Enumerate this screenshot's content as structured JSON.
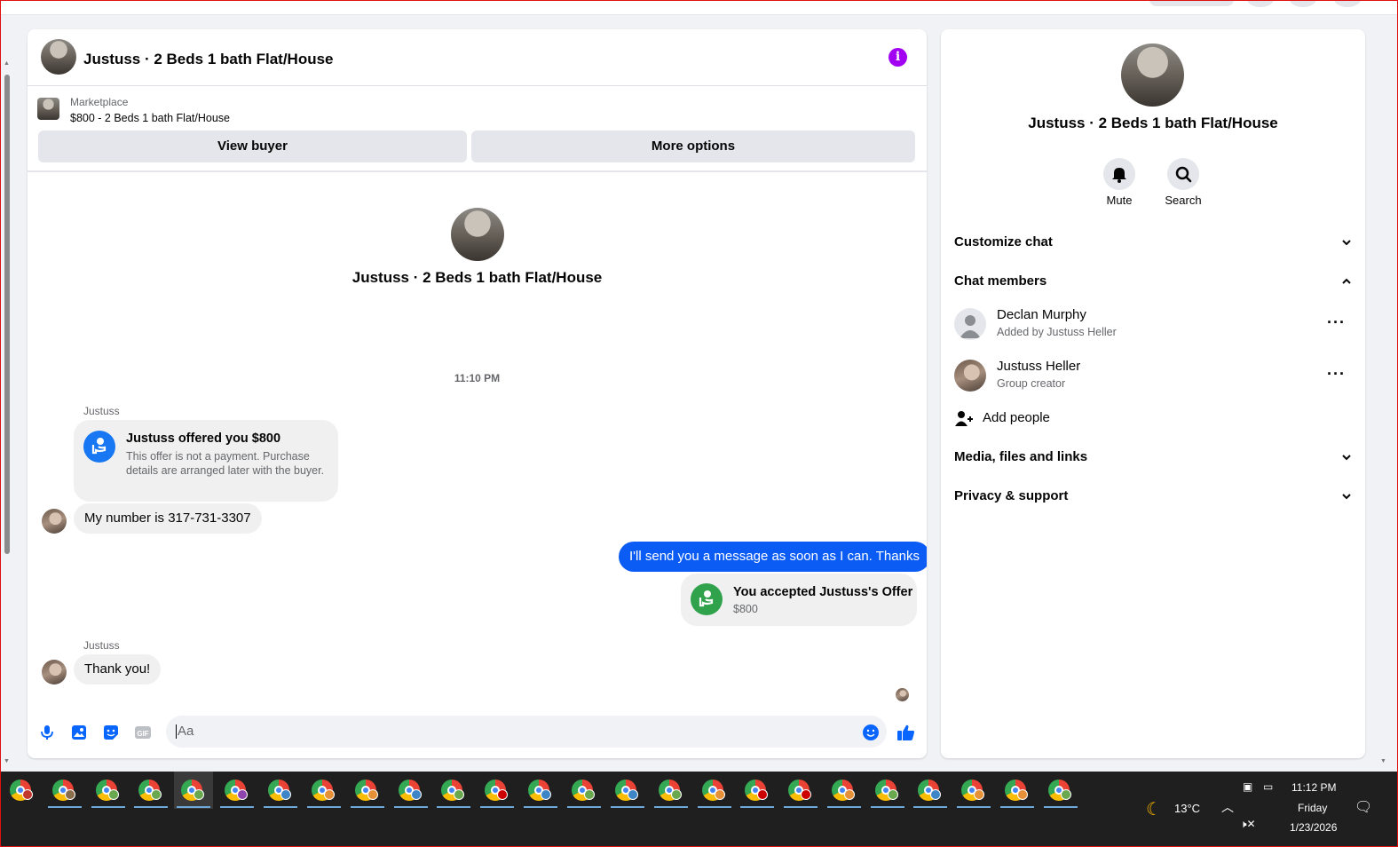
{
  "chat": {
    "header_title": "Justuss · 2 Beds 1 bath Flat/House",
    "marketplace_label": "Marketplace",
    "listing": "$800 - 2 Beds 1 bath Flat/House",
    "view_buyer_label": "View buyer",
    "more_options_label": "More options",
    "center_title": "Justuss · 2 Beds 1 bath Flat/House",
    "timestamp": "11:10 PM",
    "messages": [
      {
        "sender": "Justuss",
        "offer_title": "Justuss offered you $800",
        "offer_text": "This offer is not a payment. Purchase details are arranged later with the buyer."
      },
      {
        "text": "My number is 317-731-3307"
      },
      {
        "text": "I'll send you a message as soon as I can. Thanks"
      },
      {
        "accept_title": "You accepted Justuss's Offer",
        "accept_amount": "$800"
      },
      {
        "sender": "Justuss",
        "text": "Thank you!"
      }
    ],
    "composer_placeholder": "Aa"
  },
  "side": {
    "title": "Justuss · 2 Beds 1 bath Flat/House",
    "actions": [
      {
        "label": "Mute"
      },
      {
        "label": "Search"
      }
    ],
    "sections": {
      "customize": "Customize chat",
      "members": "Chat members",
      "media": "Media, files and links",
      "privacy": "Privacy & support"
    },
    "members": [
      {
        "name": "Declan Murphy",
        "sub": "Added by Justuss Heller"
      },
      {
        "name": "Justuss Heller",
        "sub": "Group creator"
      }
    ],
    "add_people": "Add people"
  },
  "taskbar": {
    "weather": "13°C",
    "time": "11:12 PM",
    "day": "Friday",
    "date": "1/23/2026"
  }
}
